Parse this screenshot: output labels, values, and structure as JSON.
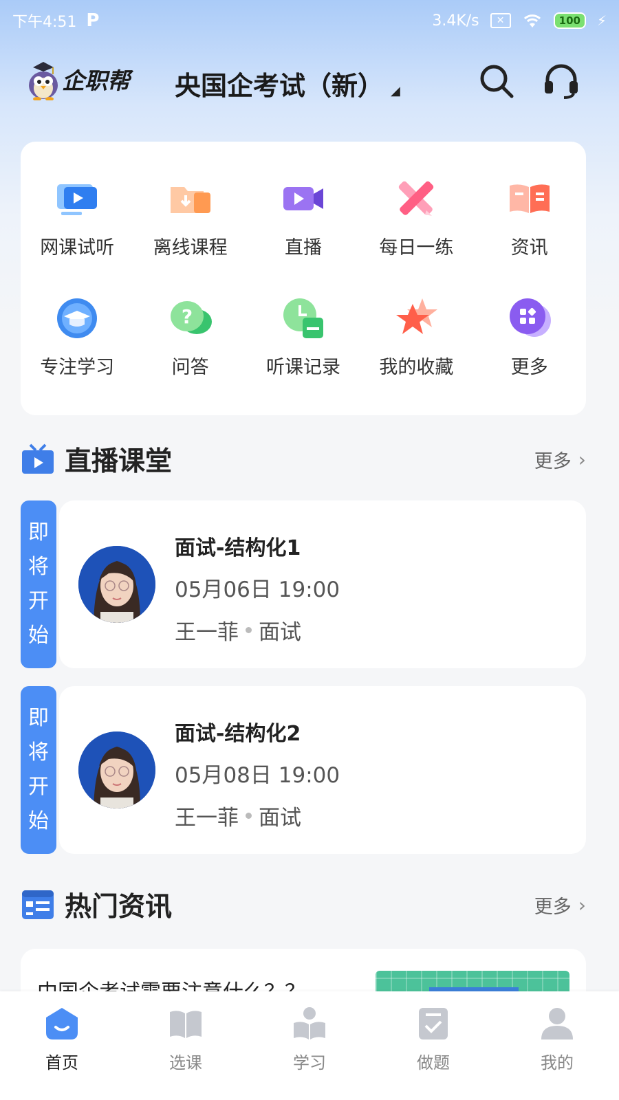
{
  "status_bar": {
    "time": "下午4:51",
    "net_speed": "3.4K/s",
    "battery": "100"
  },
  "header": {
    "app_name": "企职帮",
    "exam_name": "央国企考试（新）"
  },
  "menu": {
    "row1": [
      {
        "label": "网课试听",
        "icon": "video-play-icon"
      },
      {
        "label": "离线课程",
        "icon": "download-folder-icon"
      },
      {
        "label": "直播",
        "icon": "live-camera-icon"
      },
      {
        "label": "每日一练",
        "icon": "pencil-icon"
      },
      {
        "label": "资讯",
        "icon": "book-icon"
      }
    ],
    "row2": [
      {
        "label": "专注学习",
        "icon": "graduation-cap-icon"
      },
      {
        "label": "问答",
        "icon": "question-bubble-icon"
      },
      {
        "label": "听课记录",
        "icon": "clock-record-icon"
      },
      {
        "label": "我的收藏",
        "icon": "star-icon"
      },
      {
        "label": "更多",
        "icon": "grid-more-icon"
      }
    ]
  },
  "live_section": {
    "title": "直播课堂",
    "more": "更多"
  },
  "live_items": [
    {
      "tag": [
        "即",
        "将",
        "开",
        "始"
      ],
      "title": "面试-结构化1",
      "time": "05月06日 19:00",
      "teacher": "王一菲",
      "category": "面试"
    },
    {
      "tag": [
        "即",
        "将",
        "开",
        "始"
      ],
      "title": "面试-结构化2",
      "time": "05月08日 19:00",
      "teacher": "王一菲",
      "category": "面试"
    }
  ],
  "news_section": {
    "title": "热门资讯",
    "more": "更多"
  },
  "news_items": [
    {
      "title": "中国企考试需要注意什么？？"
    }
  ],
  "bottom_nav": [
    {
      "label": "首页",
      "active": true
    },
    {
      "label": "选课",
      "active": false
    },
    {
      "label": "学习",
      "active": false
    },
    {
      "label": "做题",
      "active": false
    },
    {
      "label": "我的",
      "active": false
    }
  ],
  "colors": {
    "accent": "#4c8ef5",
    "active_nav": "#4c8ef5",
    "inactive_nav": "#c5c8cf"
  }
}
